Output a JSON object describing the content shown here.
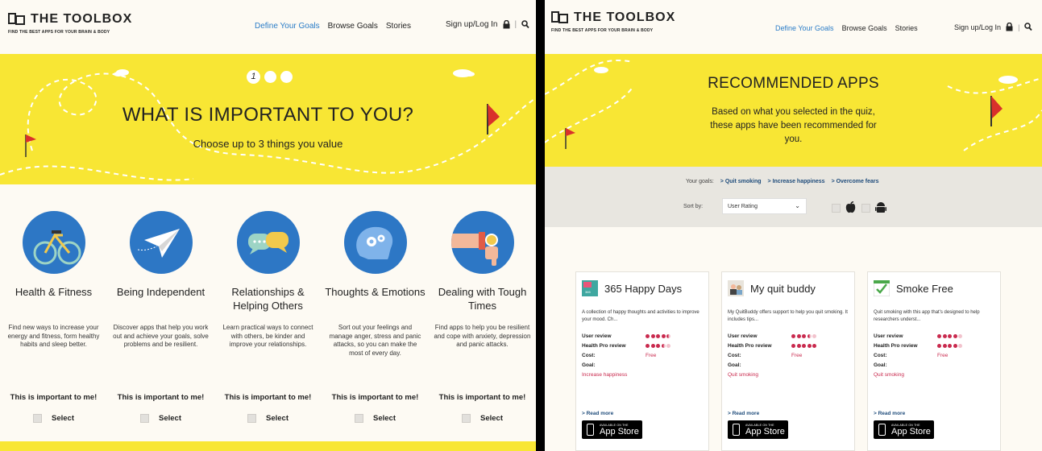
{
  "header": {
    "logo_name": "THE TOOLBOX",
    "logo_tagline": "FIND THE BEST APPS FOR YOUR BRAIN & BODY",
    "nav": [
      "Define Your Goals",
      "Browse Goals",
      "Stories"
    ],
    "account_link": "Sign up/Log In",
    "active_color": "#2a7cc7"
  },
  "quiz": {
    "steps": [
      "1",
      "",
      ""
    ],
    "title": "WHAT IS IMPORTANT TO YOU?",
    "subtitle": "Choose up to 3 things you value",
    "important_label": "This is important to me!",
    "select_label": "Select",
    "values": [
      {
        "title": "Health & Fitness",
        "description": "Find new ways to increase your energy and fitness, form healthy habits and sleep better.",
        "icon": "bicycle-icon"
      },
      {
        "title": "Being Independent",
        "description": "Discover apps that help you work out and achieve your goals, solve problems and be resilient.",
        "icon": "paper-plane-icon"
      },
      {
        "title": "Relationships & Helping Others",
        "description": "Learn practical ways to connect with others, be kinder and improve your relationships.",
        "icon": "speech-bubbles-icon"
      },
      {
        "title": "Thoughts & Emotions",
        "description": "Sort out your feelings and manage anger, stress and panic attacks, so you can make the most of every day.",
        "icon": "brain-gears-icon"
      },
      {
        "title": "Dealing with Tough Times",
        "description": "Find apps to help you be resilient and cope with anxiety, depression and panic attacks.",
        "icon": "thumbs-down-watch-icon"
      }
    ]
  },
  "recommended": {
    "title": "RECOMMENDED APPS",
    "subtitle": "Based on what you selected in the quiz, these apps have been recommended for you.",
    "goals_label": "Your goals:",
    "goals": [
      "> Quit smoking",
      "> Increase happiness",
      "> Overcome fears"
    ],
    "sort_label": "Sort by:",
    "sort_value": "User Rating",
    "labels": {
      "user_review": "User review",
      "health_pro_review": "Health Pro review",
      "cost": "Cost:",
      "goal": "Goal:",
      "read_more": "> Read more",
      "store_small": "AVAILABLE ON THE",
      "store_big": "App Store"
    },
    "apps": [
      {
        "name": "365 Happy Days",
        "description": "A collection of happy thoughts and activities to improve your mood. Ch...",
        "user_review": 4.5,
        "health_pro_review": 3.5,
        "cost": "Free",
        "goal": "Increase happiness",
        "icon": "happy-days-app-icon"
      },
      {
        "name": "My quit buddy",
        "description": "My QuitBuddy offers support to help you quit smoking. It includes tips...",
        "user_review": 3.5,
        "health_pro_review": 5,
        "cost": "Free",
        "goal": "Quit smoking",
        "icon": "quit-buddy-app-icon"
      },
      {
        "name": "Smoke Free",
        "description": "Quit smoking with this app that's designed to help researchers underst...",
        "user_review": 4,
        "health_pro_review": 4,
        "cost": "Free",
        "goal": "Quit smoking",
        "icon": "smoke-free-app-icon"
      }
    ],
    "rating_color": "#c92a4e"
  },
  "colors": {
    "hero_yellow": "#f8e634",
    "value_circle": "#2d77c5",
    "link_blue": "#1f4c7b"
  }
}
